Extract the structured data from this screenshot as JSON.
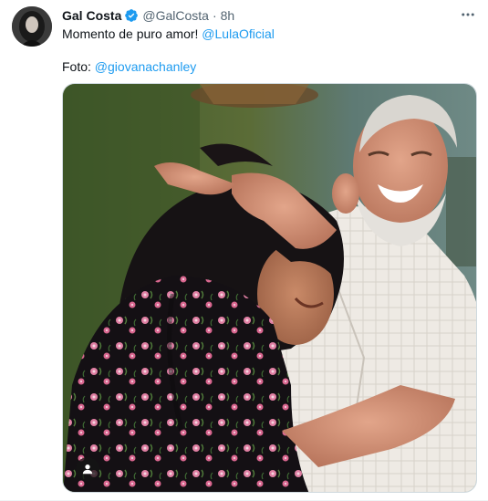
{
  "tweet": {
    "author_name": "Gal Costa",
    "author_handle": "@GalCosta",
    "separator": "·",
    "timestamp": "8h",
    "text_line1": "Momento de puro amor! ",
    "mention1": "@LulaOficial",
    "text_line2": "Foto: ",
    "mention2": "@giovanachanley"
  },
  "icons": {
    "verified": "verified-badge-icon",
    "more": "more-options-icon",
    "person": "person-icon"
  },
  "colors": {
    "accent": "#1d9bf0",
    "secondary_text": "#536471",
    "primary_text": "#0f1419"
  }
}
